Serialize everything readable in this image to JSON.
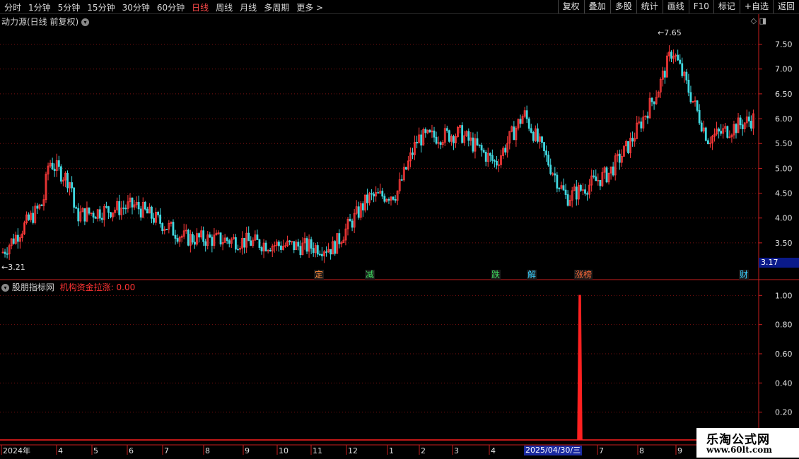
{
  "toolbar": {
    "periods": [
      "分时",
      "1分钟",
      "5分钟",
      "15分钟",
      "30分钟",
      "60分钟",
      "日线",
      "周线",
      "月线",
      "多周期",
      "更多 >"
    ],
    "active_period": "日线",
    "buttons": [
      "复权",
      "叠加",
      "多股",
      "统计",
      "画线",
      "F10",
      "标记",
      "+自选",
      "返回"
    ]
  },
  "main_chart": {
    "title": "动力源(日线 前复权)",
    "high_label": "7.65",
    "low_label": "3.21",
    "latest_price": "3.17",
    "price_ticks": [
      "7.50",
      "7.00",
      "6.50",
      "6.00",
      "5.50",
      "5.00",
      "4.50",
      "4.00",
      "3.50"
    ],
    "event_tags": [
      {
        "text": "定",
        "color": "#ff8a3a"
      },
      {
        "text": "减",
        "color": "#40e060"
      },
      {
        "text": "跌",
        "color": "#40e060"
      },
      {
        "text": "解",
        "color": "#3ad0ff"
      },
      {
        "text": "涨榜",
        "color": "#ff6a3a"
      },
      {
        "text": "财",
        "color": "#3ad0ff"
      }
    ],
    "colors": {
      "up": "#ff3a3a",
      "down": "#40d8e0",
      "grid": "#7a1010",
      "axis": "#c81e1e"
    }
  },
  "sub_chart": {
    "indicator_name": "股朋指标网",
    "indicator_label": "机构资金拉涨: 0.00",
    "ticks": [
      "1.00",
      "0.80",
      "0.60",
      "0.40",
      "0.20"
    ]
  },
  "date_axis": {
    "labels": [
      "2024年",
      "4",
      "5",
      "6",
      "7",
      "8",
      "9",
      "10",
      "11",
      "12",
      "1",
      "2",
      "3",
      "4",
      "7",
      "8",
      "9"
    ],
    "cursor_date": "2025/04/30/三"
  },
  "watermark": {
    "line1": "乐淘公式网",
    "line2": "www.60lt.com"
  },
  "chart_data": {
    "type": "candlestick",
    "title": "动力源(日线 前复权)",
    "ylim": [
      3.2,
      7.75
    ],
    "close_points": [
      {
        "x": "2024-01",
        "y": 3.3
      },
      {
        "x": "2024-02",
        "y": 4.3
      },
      {
        "x": "2024-03",
        "y": 5.15
      },
      {
        "x": "2024-03",
        "y": 4.7
      },
      {
        "x": "2024-04",
        "y": 4.05
      },
      {
        "x": "2024-05",
        "y": 4.25
      },
      {
        "x": "2024-06",
        "y": 3.6
      },
      {
        "x": "2024-07",
        "y": 3.55
      },
      {
        "x": "2024-08",
        "y": 3.45
      },
      {
        "x": "2024-09",
        "y": 3.4
      },
      {
        "x": "2024-10",
        "y": 4.4
      },
      {
        "x": "2024-11",
        "y": 4.5
      },
      {
        "x": "2024-12",
        "y": 5.6
      },
      {
        "x": "2025-01",
        "y": 5.7
      },
      {
        "x": "2025-02",
        "y": 5.1
      },
      {
        "x": "2025-03",
        "y": 6.1
      },
      {
        "x": "2025-04",
        "y": 4.4
      },
      {
        "x": "2025-05",
        "y": 4.9
      },
      {
        "x": "2025-06",
        "y": 5.5
      },
      {
        "x": "2025-07",
        "y": 6.6
      },
      {
        "x": "2025-08",
        "y": 7.4
      },
      {
        "x": "2025-09",
        "y": 5.6
      },
      {
        "x": "2025-09",
        "y": 6.0
      }
    ],
    "indicator": {
      "name": "机构资金拉涨",
      "spike_date": "2025/04/30",
      "spike_value": 1.0,
      "ylim": [
        0,
        1.05
      ]
    }
  }
}
